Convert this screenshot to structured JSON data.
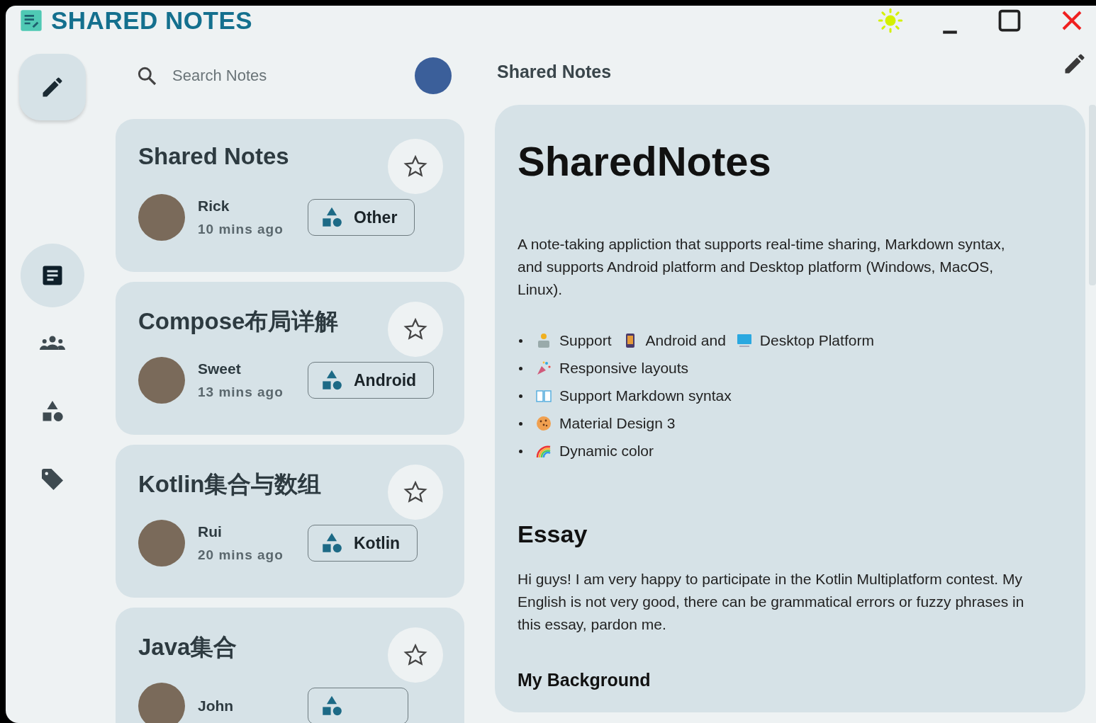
{
  "window": {
    "title": "SHARED NOTES"
  },
  "nav": [
    {
      "selected": true
    },
    {
      "selected": false
    },
    {
      "selected": false
    },
    {
      "selected": false
    }
  ],
  "search": {
    "placeholder": "Search Notes"
  },
  "notes": [
    {
      "title": "Shared Notes",
      "author": "Rick",
      "time": "10 mins ago",
      "tag": "Other",
      "favorite": false
    },
    {
      "title": "Compose布局详解",
      "author": "Sweet",
      "time": "13 mins ago",
      "tag": "Android",
      "favorite": false
    },
    {
      "title": "Kotlin集合与数组",
      "author": "Rui",
      "time": "20 mins ago",
      "tag": "Kotlin",
      "favorite": false
    },
    {
      "title": "Java集合",
      "author": "John",
      "favorite": false
    }
  ],
  "detail": {
    "title": "Shared Notes",
    "content": [
      {
        "kind": "h1",
        "text": "SharedNotes"
      },
      {
        "kind": "p",
        "text": "A note-taking appliction that supports real-time sharing, Markdown syntax, and supports Android platform and Desktop platform (Windows, MacOS, Linux)."
      },
      {
        "kind": "ul",
        "items": [
          {
            "parts": [
              "Support",
              "Android and",
              "Desktop Platform"
            ]
          },
          {
            "parts": [
              "Responsive layouts"
            ]
          },
          {
            "parts": [
              "Support Markdown syntax"
            ]
          },
          {
            "parts": [
              "Material Design 3"
            ]
          },
          {
            "parts": [
              "Dynamic color"
            ]
          }
        ]
      },
      {
        "kind": "h2",
        "text": "Essay"
      },
      {
        "kind": "p",
        "text": "Hi guys! I am very happy to participate in the Kotlin Multiplatform contest. My English is not very good, there can be grammatical errors or fuzzy phrases in this essay, pardon me."
      },
      {
        "kind": "h3",
        "text": "My Background"
      }
    ]
  }
}
